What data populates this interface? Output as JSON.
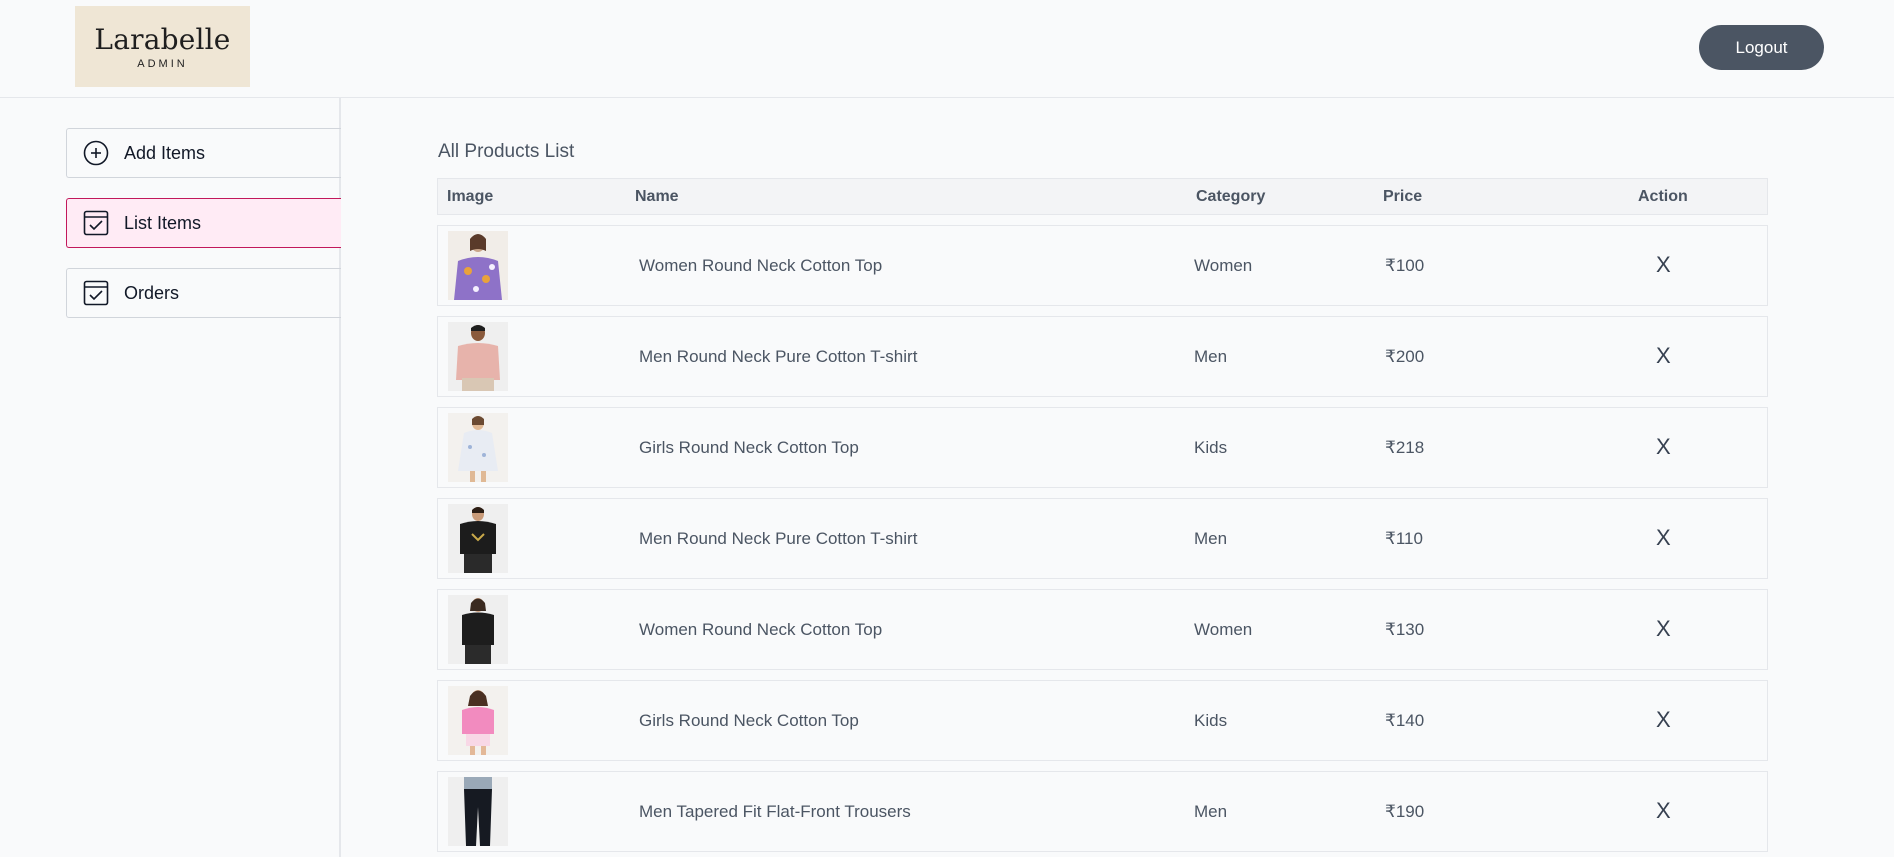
{
  "brand": {
    "name": "Larabelle",
    "sub": "ADMIN"
  },
  "header": {
    "logout_label": "Logout"
  },
  "sidebar": {
    "items": [
      {
        "label": "Add Items",
        "icon": "plus-circle-icon"
      },
      {
        "label": "List Items",
        "icon": "checklist-icon",
        "active": true
      },
      {
        "label": "Orders",
        "icon": "checklist-icon"
      }
    ]
  },
  "main": {
    "title": "All Products List",
    "columns": [
      "Image",
      "Name",
      "Category",
      "Price",
      "Action"
    ],
    "rows": [
      {
        "name": "Women Round Neck Cotton Top",
        "category": "Women",
        "price": "₹100",
        "action": "X"
      },
      {
        "name": "Men Round Neck Pure Cotton T-shirt",
        "category": "Men",
        "price": "₹200",
        "action": "X"
      },
      {
        "name": "Girls Round Neck Cotton Top",
        "category": "Kids",
        "price": "₹218",
        "action": "X"
      },
      {
        "name": "Men Round Neck Pure Cotton T-shirt",
        "category": "Men",
        "price": "₹110",
        "action": "X"
      },
      {
        "name": "Women Round Neck Cotton Top",
        "category": "Women",
        "price": "₹130",
        "action": "X"
      },
      {
        "name": "Girls Round Neck Cotton Top",
        "category": "Kids",
        "price": "₹140",
        "action": "X"
      },
      {
        "name": "Men Tapered Fit Flat-Front Trousers",
        "category": "Men",
        "price": "₹190",
        "action": "X"
      }
    ]
  },
  "colors": {
    "accent": "#c2185b",
    "active_bg": "#ffebf5",
    "logout_bg": "#4b5563",
    "logo_bg": "#efe6d5"
  }
}
